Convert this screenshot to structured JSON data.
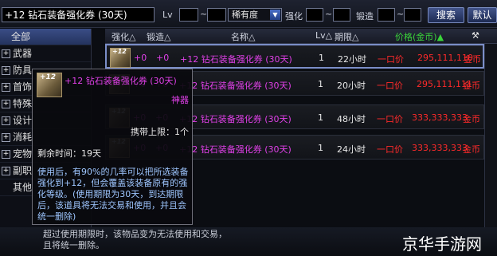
{
  "search": {
    "value": "+12 钻石装备强化券 (30天)"
  },
  "filters": {
    "lv_label": "Lv",
    "tilde": "~",
    "rarity_value": "稀有度",
    "enhance_label": "强化",
    "forge_label": "锻造"
  },
  "buttons": {
    "search": "搜索",
    "default": "默认"
  },
  "categories": [
    {
      "label": "全部"
    },
    {
      "label": "武器"
    },
    {
      "label": "防具"
    },
    {
      "label": "首饰"
    },
    {
      "label": "特殊"
    },
    {
      "label": "设计"
    },
    {
      "label": "消耗"
    },
    {
      "label": "宠物"
    },
    {
      "label": "副职"
    },
    {
      "label": "其他"
    }
  ],
  "columns": {
    "enhance": "强化△",
    "forge": "锻造△",
    "name": "名称△",
    "lv": "Lv△",
    "period": "期限△",
    "price": "价格(金币)▲"
  },
  "rows": [
    {
      "enhance": "+0",
      "forge": "+0",
      "name": "+12 钻石装备强化券 (30天)",
      "lv": "1",
      "period": "22小时",
      "buy": "一口价",
      "price": "295,111,110",
      "unit": "金币"
    },
    {
      "enhance": "+0",
      "forge": "+0",
      "name": "+12 钻石装备强化券 (30天)",
      "lv": "1",
      "period": "20小时",
      "buy": "一口价",
      "price": "295,111,111",
      "unit": "金币"
    },
    {
      "enhance": "+0",
      "forge": "+0",
      "name": "+12 钻石装备强化券 (30天)",
      "lv": "1",
      "period": "48小时",
      "buy": "一口价",
      "price": "333,333,333",
      "unit": "金币"
    },
    {
      "enhance": "+0",
      "forge": "+0",
      "name": "+12 钻石装备强化券 (30天)",
      "lv": "1",
      "period": "24小时",
      "buy": "一口价",
      "price": "333,333,333",
      "unit": "金币"
    }
  ],
  "icon_tag": "+12",
  "tooltip": {
    "title": "+12 钻石装备强化券 (30天)",
    "type": "神器",
    "stack": "携带上限：1个",
    "remaining": "剩余时间：19天",
    "description": "使用后，有90%的几率可以把所选装备强化到+12，但会覆盖该装备原有的强化等级。(使用期限为30天，到达期限后，该道具将无法交易和使用，并且会统一删除)"
  },
  "notice": "超过使用期限时，该物品变为无法使用和交易，且将统一删除。",
  "watermark": "京华手游网",
  "colors": {
    "item_name": "#e040e8",
    "price": "#ff2a2a",
    "price_header": "#3ad43a"
  }
}
